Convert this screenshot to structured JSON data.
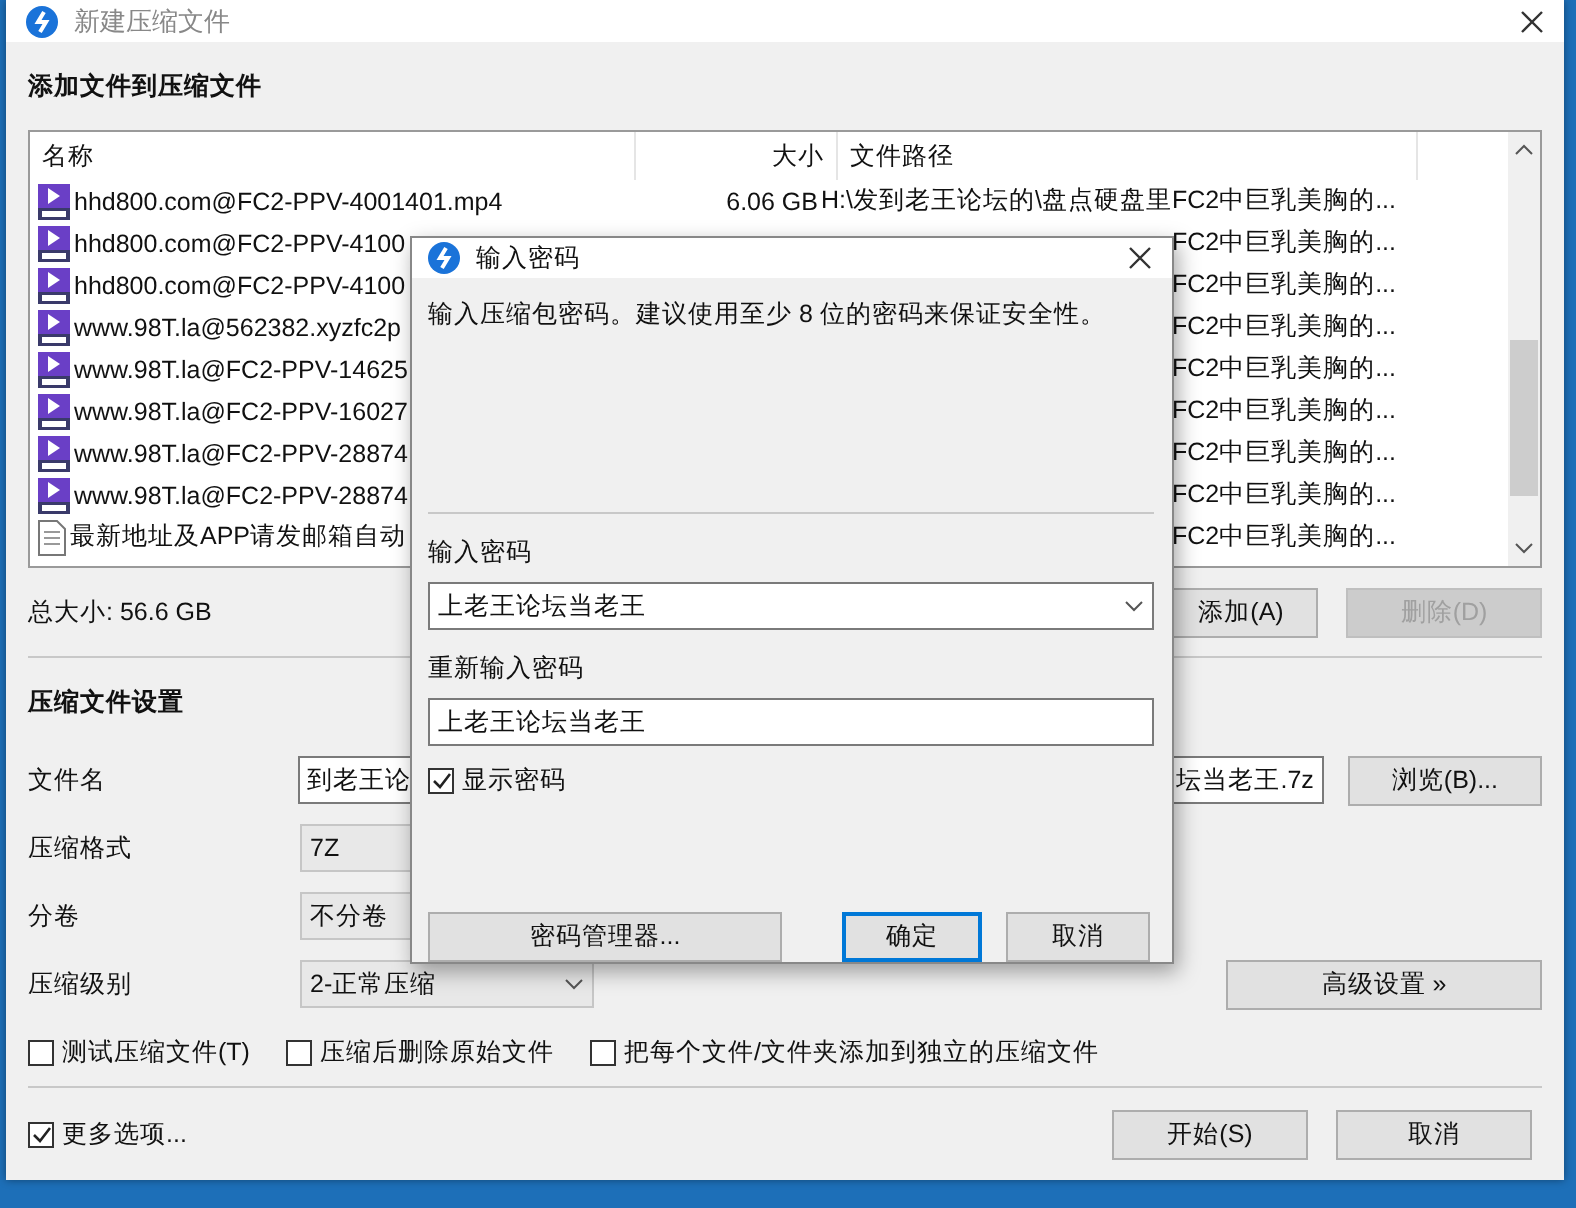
{
  "window": {
    "title": "新建压缩文件"
  },
  "files_section": {
    "heading": "添加文件到压缩文件",
    "columns": [
      "名称",
      "大小",
      "文件路径"
    ],
    "rows": [
      {
        "kind": "video",
        "name": "hhd800.com@FC2-PPV-4001401.mp4",
        "size": "6.06 GB",
        "path": "H:\\发到老王论坛的\\盘点硬盘里FC2中巨乳美胸的..."
      },
      {
        "kind": "video",
        "name": "hhd800.com@FC2-PPV-4100",
        "path": "FC2中巨乳美胸的..."
      },
      {
        "kind": "video",
        "name": "hhd800.com@FC2-PPV-4100",
        "path": "FC2中巨乳美胸的..."
      },
      {
        "kind": "video",
        "name": "www.98T.la@562382.xyzfc2p",
        "path": "FC2中巨乳美胸的..."
      },
      {
        "kind": "video",
        "name": "www.98T.la@FC2-PPV-14625",
        "path": "FC2中巨乳美胸的..."
      },
      {
        "kind": "video",
        "name": "www.98T.la@FC2-PPV-16027",
        "path": "FC2中巨乳美胸的..."
      },
      {
        "kind": "video",
        "name": "www.98T.la@FC2-PPV-28874",
        "path": "FC2中巨乳美胸的..."
      },
      {
        "kind": "video",
        "name": "www.98T.la@FC2-PPV-28874",
        "path": "FC2中巨乳美胸的..."
      },
      {
        "kind": "text",
        "name": "最新地址及APP请发邮箱自动",
        "path": "FC2中巨乳美胸的..."
      }
    ],
    "total": "总大小: 56.6 GB",
    "buttons": [
      {
        "label": "添加(A)",
        "disabled": false
      },
      {
        "label": "删除(D)",
        "disabled": true
      }
    ]
  },
  "settings": {
    "heading": "压缩文件设置",
    "filename": {
      "label": "文件名",
      "value_parts": [
        "到老王论",
        "坛当老王.7z"
      ],
      "button": "浏览(B)..."
    },
    "format": {
      "label": "压缩格式",
      "value": "7Z"
    },
    "volume": {
      "label": "分卷",
      "value": "不分卷"
    },
    "level": {
      "label": "压缩级别",
      "value": "2-正常压缩"
    },
    "advanced_button": "高级设置 »",
    "options": [
      {
        "label": "测试压缩文件(T)",
        "checked": false
      },
      {
        "label": "压缩后删除原始文件",
        "checked": false
      },
      {
        "label": "把每个文件/文件夹添加到独立的压缩文件",
        "checked": false
      }
    ]
  },
  "footer": {
    "more_options": {
      "label": "更多选项...",
      "checked": true
    },
    "start_button": "开始(S)",
    "cancel_button": "取消"
  },
  "dialog": {
    "title": "输入密码",
    "description": "输入压缩包密码。建议使用至少 8 位的密码来保证安全性。",
    "password_label": "输入密码",
    "password_value": "上老王论坛当老王",
    "repeat_label": "重新输入密码",
    "repeat_value": "上老王论坛当老王",
    "show_password": {
      "label": "显示密码",
      "checked": true
    },
    "manager_button": "密码管理器...",
    "ok_button": "确定",
    "cancel_button": "取消"
  }
}
